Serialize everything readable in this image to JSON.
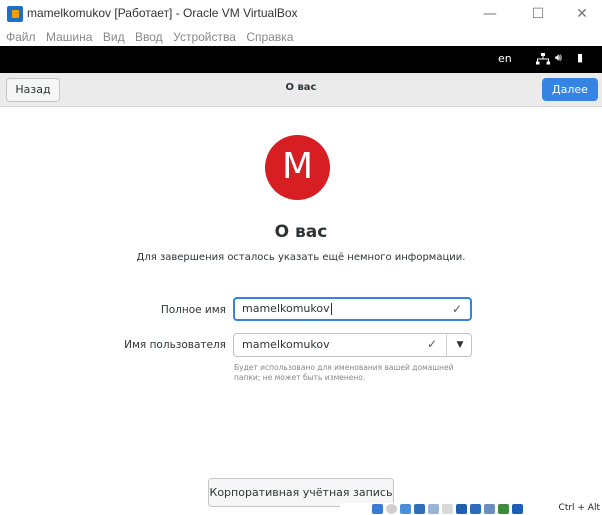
{
  "window": {
    "title": "mamelkomukov [Работает] - Oracle VM VirtualBox",
    "controls": {
      "minimize": "—",
      "maximize": "☐",
      "close": "✕"
    }
  },
  "menu": [
    "Файл",
    "Машина",
    "Вид",
    "Ввод",
    "Устройства",
    "Справка"
  ],
  "topbar": {
    "language": "en",
    "network_icon": "network-icon",
    "volume_icon": "volume-icon",
    "battery_icon": "battery-icon",
    "volume_glyph": "🔊︎",
    "battery_glyph": "▮"
  },
  "header": {
    "back": "Назад",
    "title": "О вас",
    "next": "Далее"
  },
  "avatar": {
    "initial": "M",
    "color": "#d71e22"
  },
  "content": {
    "title": "О вас",
    "subtitle": "Для завершения осталось указать ещё немного информации."
  },
  "form": {
    "full_name_label": "Полное имя",
    "full_name_value": "mamelkomukov",
    "username_label": "Имя пользователя",
    "username_value": "mamelkomukov",
    "username_hint": "Будет использовано для именования вашей домашней папки; не может быть изменено.",
    "check_glyph": "✓",
    "dropdown_glyph": "▼"
  },
  "enterprise_button": "Корпоративная учётная запись",
  "statusbar": {
    "host_key": "Ctrl + Alt"
  },
  "colors": {
    "accent": "#3584e4",
    "topbar": "#000000",
    "header_bg": "#ebebeb"
  }
}
